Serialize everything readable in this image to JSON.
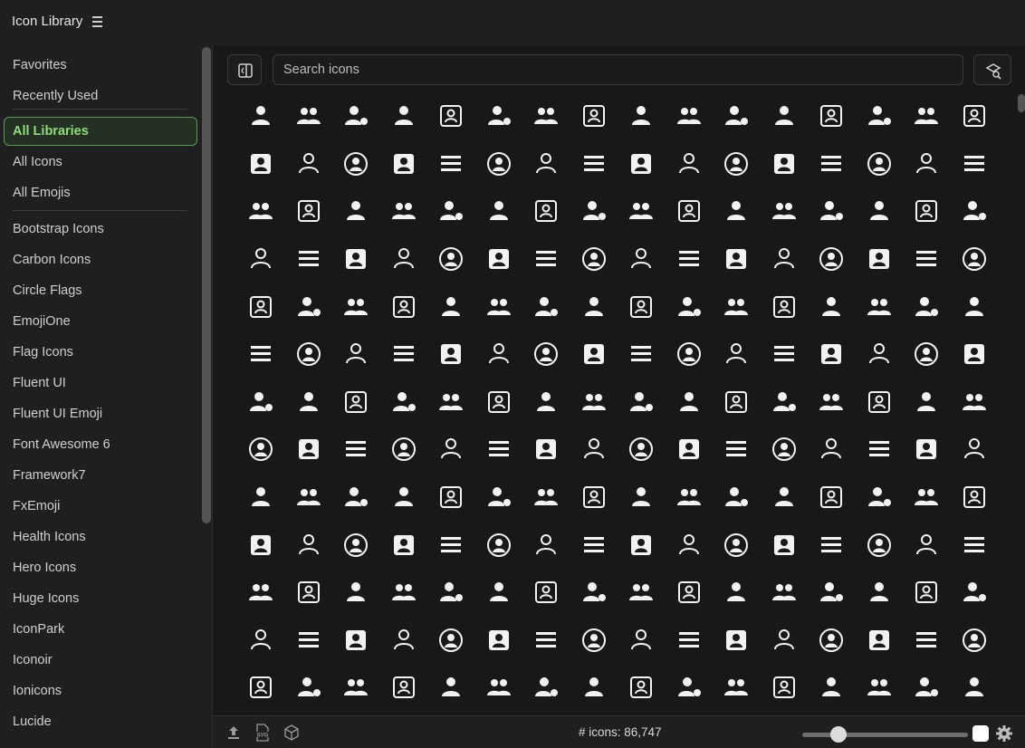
{
  "app": {
    "title": "Icon Library"
  },
  "sidebar": {
    "items": [
      {
        "label": "Favorites"
      },
      {
        "label": "Recently Used"
      },
      {
        "label": "All Libraries",
        "active": true
      },
      {
        "label": "All Icons"
      },
      {
        "label": "All Emojis"
      },
      {
        "label": "Bootstrap Icons"
      },
      {
        "label": "Carbon Icons"
      },
      {
        "label": "Circle Flags"
      },
      {
        "label": "EmojiOne"
      },
      {
        "label": "Flag Icons"
      },
      {
        "label": "Fluent UI"
      },
      {
        "label": "Fluent UI Emoji"
      },
      {
        "label": "Font Awesome 6"
      },
      {
        "label": "Framework7"
      },
      {
        "label": "FxEmoji"
      },
      {
        "label": "Health Icons"
      },
      {
        "label": "Hero Icons"
      },
      {
        "label": "Huge Icons"
      },
      {
        "label": "IconPark"
      },
      {
        "label": "Iconoir"
      },
      {
        "label": "Ionicons"
      },
      {
        "label": "Lucide"
      }
    ]
  },
  "search": {
    "placeholder": "Search icons",
    "value": ""
  },
  "grid": {
    "rows": 13,
    "columns": 16
  },
  "status": {
    "icon_count_text": "# icons: 86,747"
  },
  "size_slider": {
    "value_fraction": 0.22
  },
  "colors": {
    "accent": "#8fdc7c",
    "icon": "#f2f2f2",
    "background": "#181818",
    "sidebar": "#1f1f1f"
  }
}
